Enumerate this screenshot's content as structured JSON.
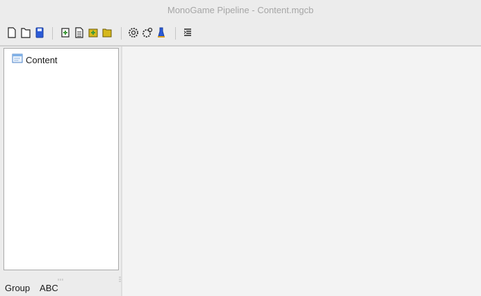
{
  "window": {
    "title": "MonoGame Pipeline - Content.mgcb"
  },
  "toolbar": {
    "items": [
      {
        "icon": "new-file-icon"
      },
      {
        "icon": "open-file-icon"
      },
      {
        "icon": "save-icon",
        "color": "#2b5bd7"
      },
      {
        "icon": "new-item-icon",
        "color": "#3e9a3a"
      },
      {
        "icon": "add-existing-item-icon"
      },
      {
        "icon": "new-folder-icon",
        "color": "#d6b81c"
      },
      {
        "icon": "existing-folder-icon",
        "color": "#d6b81c"
      },
      {
        "icon": "build-icon"
      },
      {
        "icon": "rebuild-icon"
      },
      {
        "icon": "clean-icon",
        "color": "#2b5bd7"
      },
      {
        "icon": "filter-output-icon"
      }
    ]
  },
  "project_tree": {
    "root": {
      "label": "Content",
      "icon": "project-icon"
    }
  },
  "left_footer": {
    "tabs": [
      {
        "label": "Group"
      },
      {
        "label": "ABC"
      }
    ]
  }
}
